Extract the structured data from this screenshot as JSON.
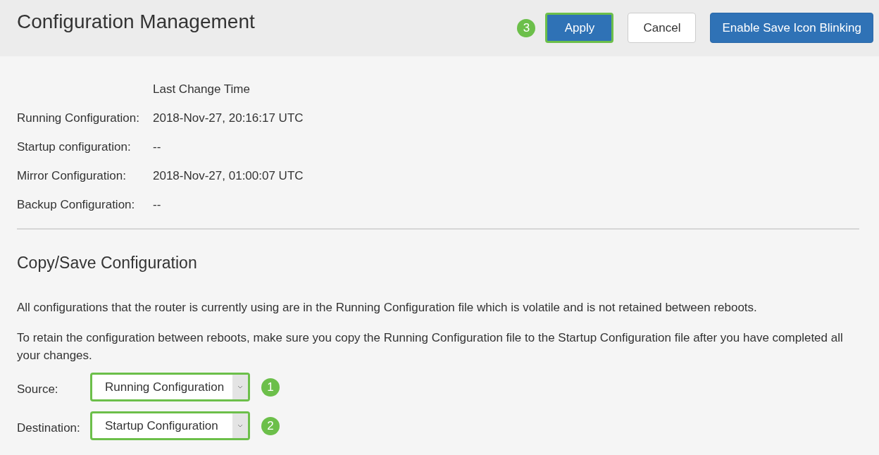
{
  "title": "Configuration Management",
  "buttons": [
    {
      "label": "Apply",
      "kind": "primary",
      "highlighted": true,
      "step": "3"
    },
    {
      "label": "Cancel",
      "kind": "secondary",
      "highlighted": false
    },
    {
      "label": "Enable Save Icon Blinking",
      "kind": "primary",
      "highlighted": false
    }
  ],
  "status": {
    "column_header": "Last Change Time",
    "rows": [
      {
        "label": "Running Configuration:",
        "value": "2018-Nov-27, 20:16:17 UTC"
      },
      {
        "label": "Startup configuration:",
        "value": "--"
      },
      {
        "label": "Mirror Configuration:",
        "value": "2018-Nov-27, 01:00:07 UTC"
      },
      {
        "label": "Backup Configuration:",
        "value": "--"
      }
    ]
  },
  "copy_section": {
    "heading": "Copy/Save Configuration",
    "paragraphs": [
      "All configurations that the router is currently using are in the Running Configuration file which is volatile and is not retained between reboots.",
      "To retain the configuration between reboots, make sure you copy the Running Configuration file to the Startup Configuration file after you have completed all your changes."
    ],
    "fields": [
      {
        "label": "Source:",
        "value": "Running Configuration",
        "highlighted": true,
        "step": "1"
      },
      {
        "label": "Destination:",
        "value": "Startup Configuration",
        "highlighted": true,
        "step": "2"
      }
    ]
  }
}
